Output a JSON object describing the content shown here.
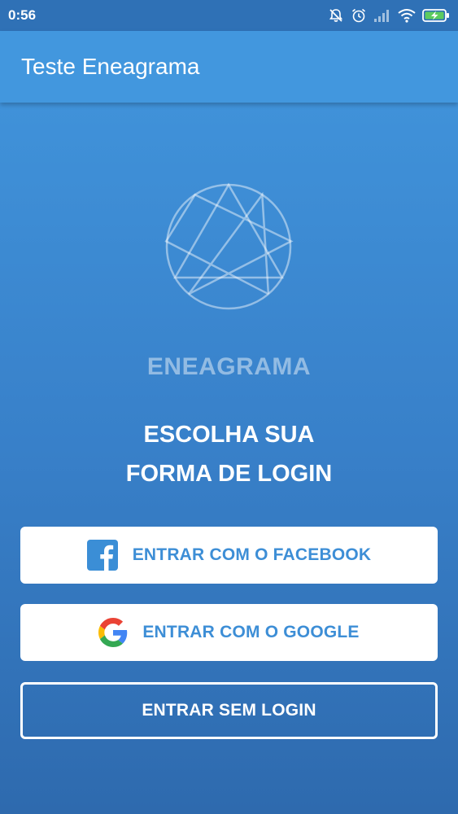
{
  "status_bar": {
    "time": "0:56",
    "icons": [
      "bell-off-icon",
      "alarm-icon",
      "signal-icon",
      "wifi-icon",
      "battery-charging-icon"
    ]
  },
  "app_bar": {
    "title": "Teste Eneagrama"
  },
  "main": {
    "logo_icon": "enneagram-logo-icon",
    "brand": "ENEAGRAMA",
    "subtitle_line1": "ESCOLHA SUA",
    "subtitle_line2": "FORMA DE LOGIN"
  },
  "buttons": {
    "facebook": {
      "label": "ENTRAR COM O FACEBOOK",
      "icon": "facebook-icon"
    },
    "google": {
      "label": "ENTRAR COM O GOOGLE",
      "icon": "google-icon"
    },
    "no_login": {
      "label": "ENTRAR SEM LOGIN"
    }
  },
  "colors": {
    "accent": "#4297de",
    "status_bar": "#2f71b6",
    "button_text": "#3d8ed6",
    "facebook": "#3b8ed6"
  }
}
